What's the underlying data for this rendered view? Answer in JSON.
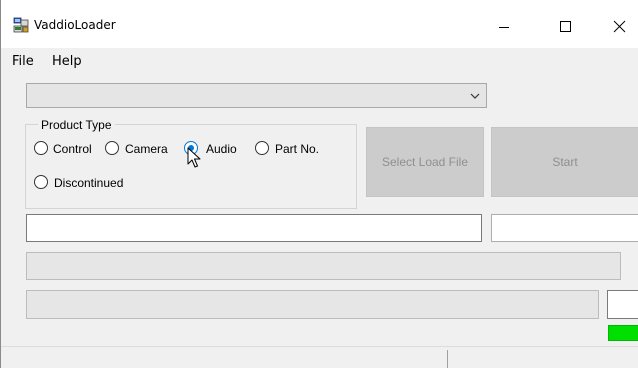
{
  "window": {
    "title": "VaddioLoader",
    "icons": {
      "app": "vaddio-loader-app-icon",
      "minimize": "minimize-icon",
      "maximize": "maximize-icon",
      "close": "close-icon"
    }
  },
  "menu": {
    "file": "File",
    "help": "Help"
  },
  "combo": {
    "value": "",
    "icon": "chevron-down-icon"
  },
  "product_type": {
    "legend": "Product Type",
    "options": [
      {
        "label": "Control",
        "checked": false
      },
      {
        "label": "Camera",
        "checked": false
      },
      {
        "label": "Audio",
        "checked": true
      },
      {
        "label": "Part No.",
        "checked": false
      },
      {
        "label": "Discontinued",
        "checked": false
      }
    ]
  },
  "buttons": {
    "select_load_file": "Select Load File",
    "start": "Start"
  },
  "fields": {
    "path_value": "",
    "right_value": "",
    "small_value": ""
  },
  "status": {
    "indicator_color": "#00e000",
    "left_text": "",
    "right_text": ""
  },
  "cursor": {
    "icon": "pointer-cursor-icon"
  }
}
